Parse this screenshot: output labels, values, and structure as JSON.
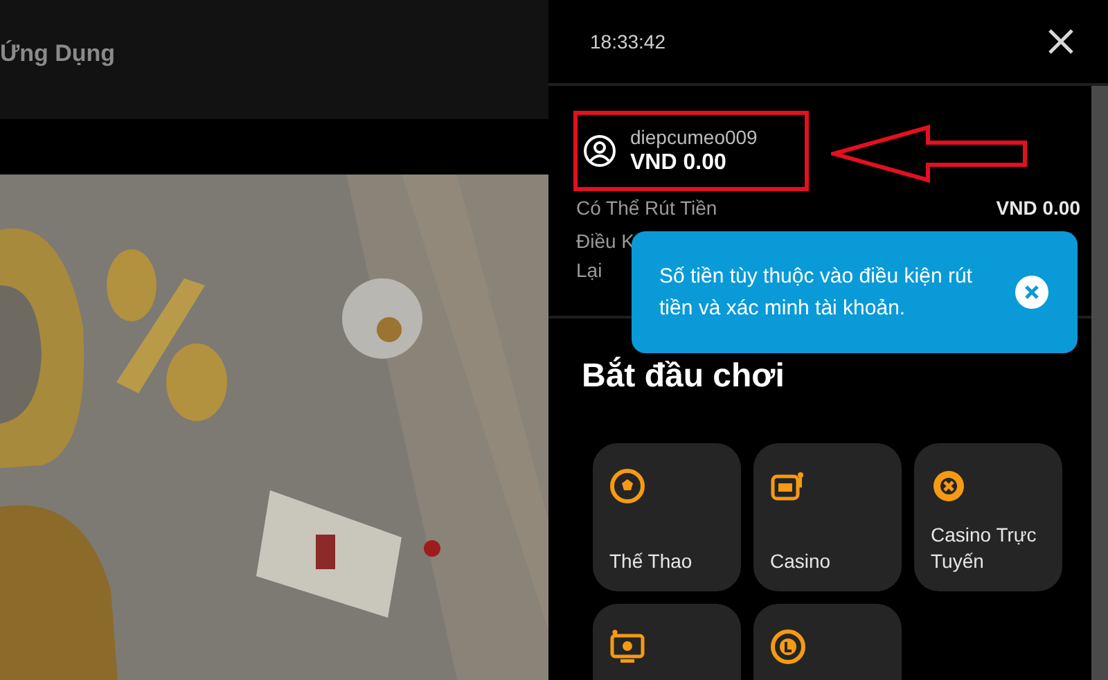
{
  "header": {
    "nav_label": "Ứng Dụng"
  },
  "panel": {
    "time": "18:33:42",
    "account": {
      "username": "diepcumeo009",
      "balance": "VND 0.00",
      "highlighted": true
    },
    "withdrawable": {
      "label": "Có Thể Rút Tiền",
      "value": "VND 0.00"
    },
    "conditions": {
      "label_lines": [
        "Điều K",
        "Lại"
      ]
    },
    "tooltip": {
      "text": "Số tiền tùy thuộc vào điều kiện rút tiền và xác minh tài khoản."
    },
    "section_title": "Bắt đầu chơi",
    "games": [
      {
        "kind": "ball",
        "label": "Thế Thao"
      },
      {
        "kind": "slot",
        "label": "Casino"
      },
      {
        "kind": "chip",
        "label": "Casino Trực Tuyến"
      },
      {
        "kind": "tv"
      },
      {
        "kind": "coin"
      }
    ]
  }
}
